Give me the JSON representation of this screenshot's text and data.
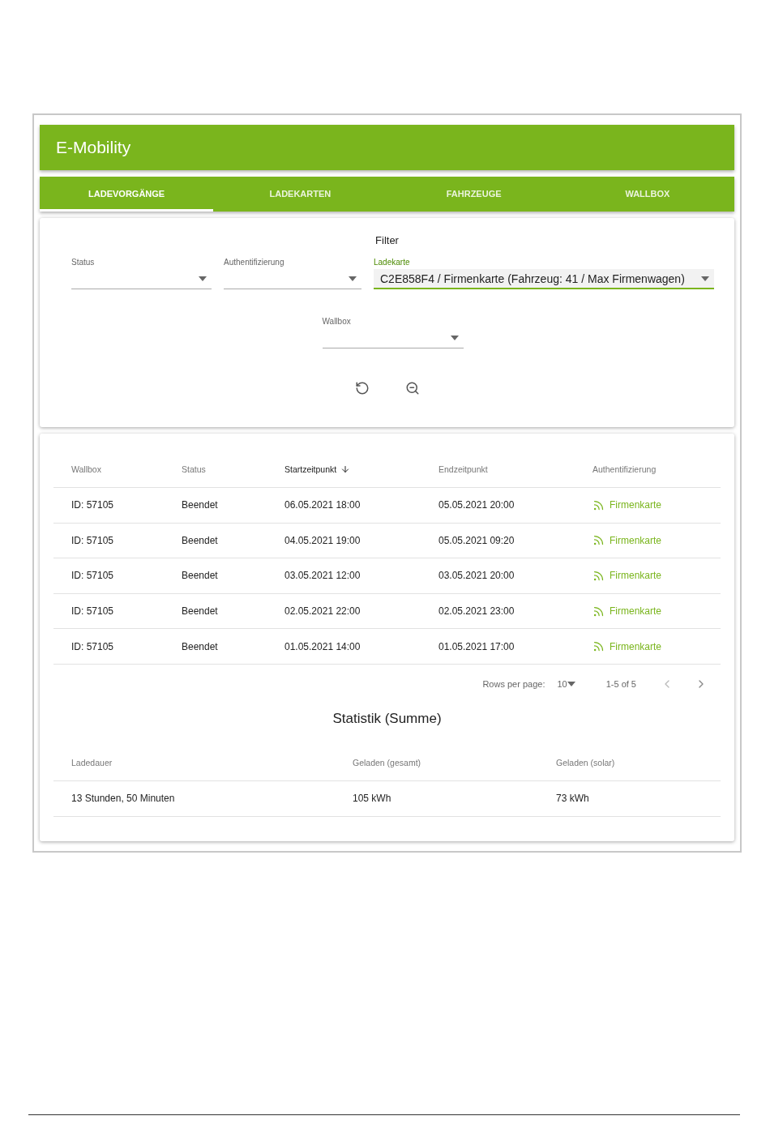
{
  "app_bar": {
    "title": "E-Mobility"
  },
  "tabs": [
    {
      "label": "LADEVORGÄNGE",
      "selected": true
    },
    {
      "label": "LADEKARTEN",
      "selected": false
    },
    {
      "label": "FAHRZEUGE",
      "selected": false
    },
    {
      "label": "WALLBOX",
      "selected": false
    }
  ],
  "filter": {
    "title": "Filter",
    "fields": [
      {
        "label": "Status",
        "focused": false
      },
      {
        "label": "Authentifizierung",
        "focused": false
      },
      {
        "label": "Ladekarte",
        "value": "C2E858F4 / Firmenkarte (Fahrzeug: 41 / Max Firmenwagen)",
        "focused": true
      },
      {
        "label": "Wallbox",
        "focused": false
      }
    ]
  },
  "table": {
    "columns": [
      {
        "label": "Wallbox",
        "sorted": false
      },
      {
        "label": "Status",
        "sorted": false
      },
      {
        "label": "Startzeitpunkt",
        "sorted": true
      },
      {
        "label": "Endzeitpunkt",
        "sorted": false
      },
      {
        "label": "Authentifizierung",
        "sorted": false
      }
    ],
    "rows": [
      [
        "ID: 57105",
        "Beendet",
        "06.05.2021 18:00",
        "05.05.2021 20:00",
        "Firmenkarte"
      ],
      [
        "ID: 57105",
        "Beendet",
        "04.05.2021 19:00",
        "05.05.2021 09:20",
        "Firmenkarte"
      ],
      [
        "ID: 57105",
        "Beendet",
        "03.05.2021 12:00",
        "03.05.2021 20:00",
        "Firmenkarte"
      ],
      [
        "ID: 57105",
        "Beendet",
        "02.05.2021 22:00",
        "02.05.2021 23:00",
        "Firmenkarte"
      ],
      [
        "ID: 57105",
        "Beendet",
        "01.05.2021 14:00",
        "01.05.2021 17:00",
        "Firmenkarte"
      ]
    ]
  },
  "pagination": {
    "rows_per_page_label": "Rows per page:",
    "rows_per_page": "10",
    "range": "1-5 of 5"
  },
  "statistics": {
    "title": "Statistik (Summe)",
    "columns": [
      "Ladedauer",
      "Geladen (gesamt)",
      "Geladen (solar)"
    ],
    "rows": [
      [
        "13 Stunden, 50 Minuten",
        "105 kWh",
        "73 kWh"
      ]
    ]
  }
}
